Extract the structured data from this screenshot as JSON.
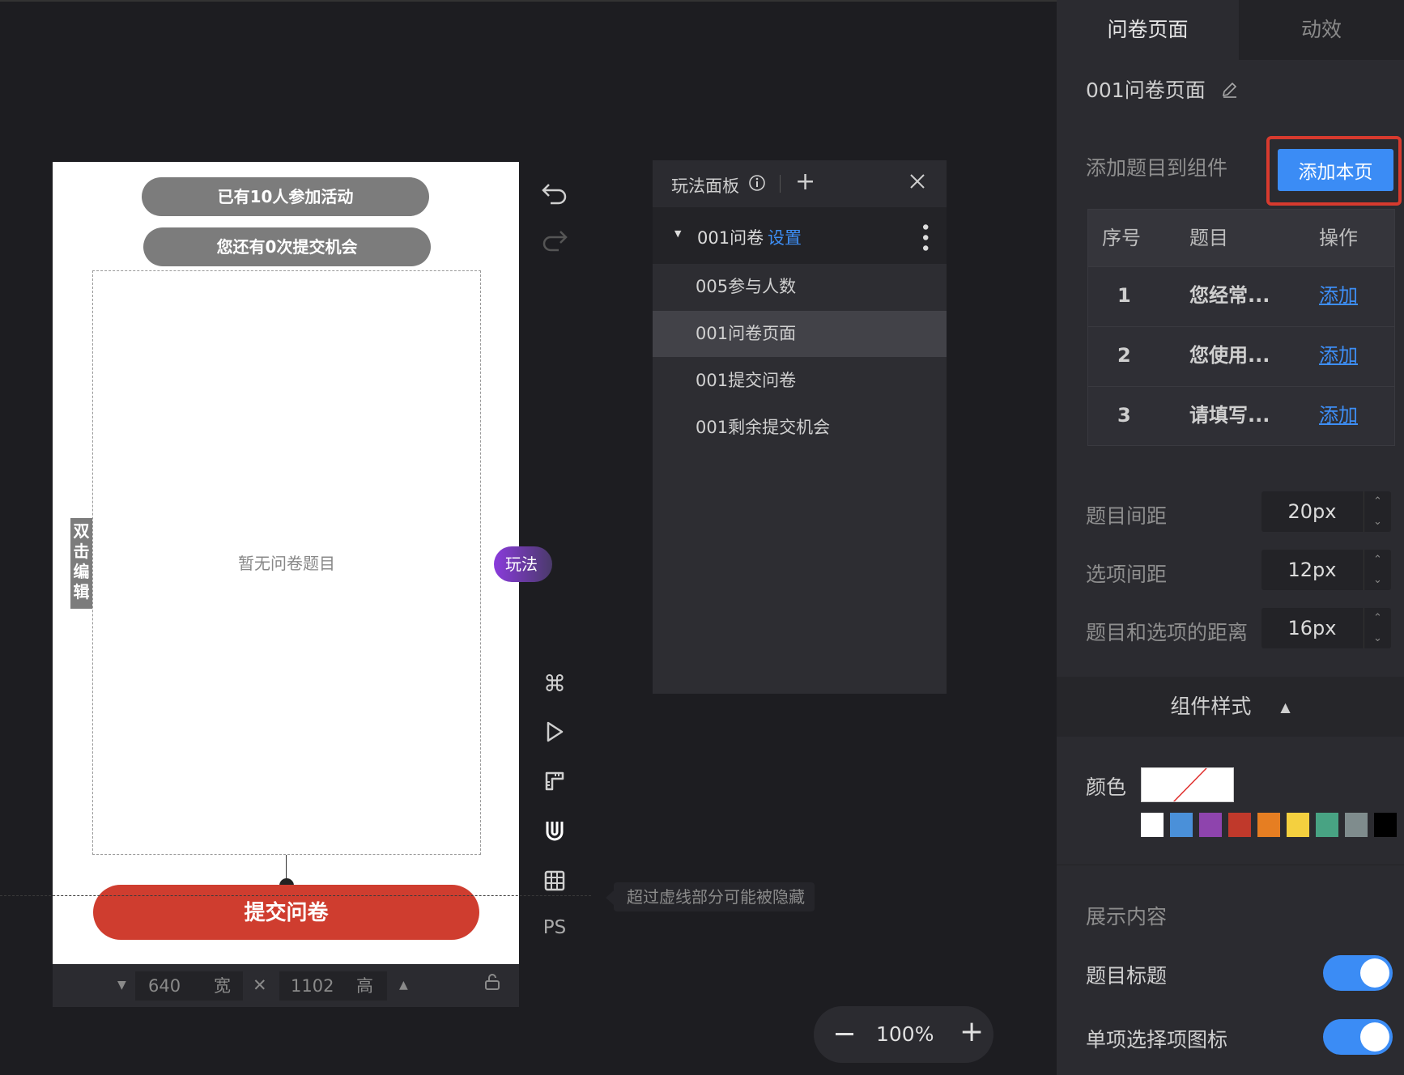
{
  "phone": {
    "pill1": "已有10人参加活动",
    "pill2": "您还有0次提交机会",
    "empty_text": "暂无问卷题目",
    "submit": "提交问卷",
    "edit_tag": "双击编辑",
    "play_tag": "玩法"
  },
  "sizebar": {
    "width": "640",
    "width_unit": "宽",
    "height": "1102",
    "height_unit": "高"
  },
  "hint": "超过虚线部分可能被隐藏",
  "toolbar": {
    "ps_label": "PS"
  },
  "play_panel": {
    "title": "玩法面板",
    "group": {
      "name": "001问卷",
      "setting": "设置"
    },
    "items": [
      {
        "label": "005参与人数",
        "active": false
      },
      {
        "label": "001问卷页面",
        "active": true
      },
      {
        "label": "001提交问卷",
        "active": false
      },
      {
        "label": "001剩余提交机会",
        "active": false
      }
    ]
  },
  "zoom": {
    "value": "100%"
  },
  "right_panel": {
    "tabs": [
      "问卷页面",
      "动效"
    ],
    "page_name": "001问卷页面",
    "add_label": "添加题目到组件",
    "add_page_button": "添加本页",
    "table": {
      "headers": [
        "序号",
        "题目",
        "操作"
      ],
      "rows": [
        {
          "no": "1",
          "title": "您经常...",
          "action": "添加"
        },
        {
          "no": "2",
          "title": "您使用...",
          "action": "添加"
        },
        {
          "no": "3",
          "title": "请填写...",
          "action": "添加"
        }
      ]
    },
    "spacing": [
      {
        "label": "题目间距",
        "value": "20px"
      },
      {
        "label": "选项间距",
        "value": "12px"
      },
      {
        "label": "题目和选项的距离",
        "value": "16px"
      }
    ],
    "style_section": "组件样式",
    "color_label": "颜色",
    "swatches": [
      "#ffffff",
      "#4a90d9",
      "#8e44ad",
      "#c0392b",
      "#e67e22",
      "#f4d03f",
      "#48a383",
      "#7f8c8d",
      "#000000"
    ],
    "display_section": "展示内容",
    "toggles": [
      {
        "label": "题目标题",
        "on": true
      },
      {
        "label": "单项选择项图标",
        "on": true
      }
    ]
  }
}
